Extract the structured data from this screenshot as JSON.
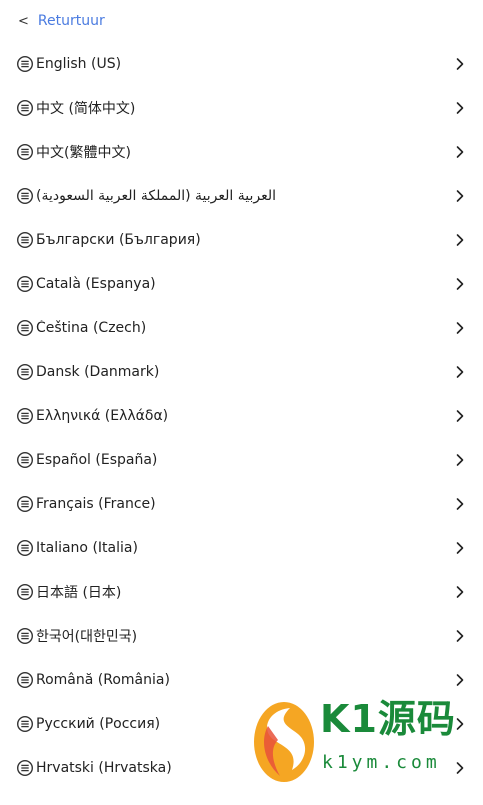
{
  "header": {
    "back_chevron": "<",
    "back_label": "Returtuur"
  },
  "colors": {
    "accent": "#4a7be0",
    "text": "#222222",
    "watermark_green": "#1a8a3a",
    "watermark_orange": "#f5a623"
  },
  "icons": {
    "item_icon": "list-circle-icon",
    "item_chevron": "chevron-right-icon"
  },
  "languages": [
    "English (US)",
    "中文 (简体中文)",
    "中文(繁體中文)",
    "العربية العربية (المملكة العربية السعودية)",
    "Български (България)",
    "Català (Espanya)",
    "Čeština (Czech)",
    "Dansk (Danmark)",
    "Ελληνικά (Ελλάδα)",
    "Español (España)",
    "Français (France)",
    "Italiano (Italia)",
    "日本語 (日本)",
    "한국어(대한민국)",
    "Română (România)",
    "Русский (Россия)",
    "Hrvatski (Hrvatska)"
  ],
  "watermark": {
    "brand": "K1源码",
    "url": "k1ym.com"
  }
}
